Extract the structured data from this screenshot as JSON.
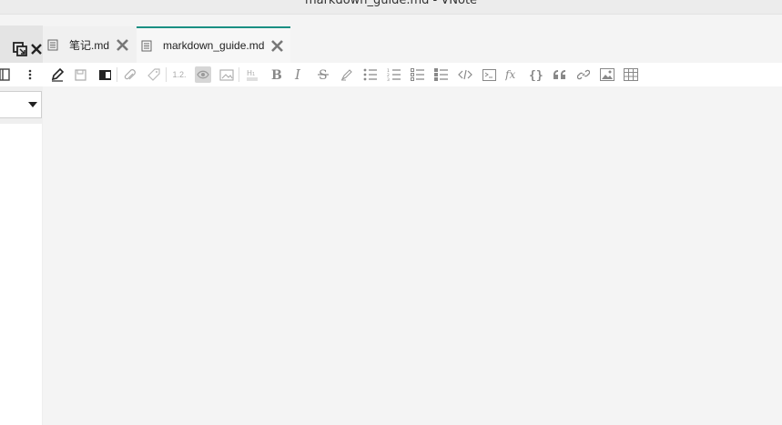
{
  "window": {
    "title": "markdown_guide.md - VNote"
  },
  "tabs": [
    {
      "label": "笔记.md",
      "active": false
    },
    {
      "label": "markdown_guide.md",
      "active": true
    }
  ],
  "colors": {
    "active_tab_accent": "#1a8f83",
    "background": "#f4f4f4",
    "icon": "#6e6e6e"
  },
  "toolbar_icons": [
    "notebook-icon",
    "more-vert-icon",
    "edit-pen-icon",
    "save-icon",
    "read-mode-icon",
    "attachment-icon",
    "tag-icon",
    "section-number-icon",
    "preview-eye-icon",
    "image-host-icon",
    "heading-icon",
    "bold-icon",
    "italic-icon",
    "strikethrough-icon",
    "highlight-icon",
    "bullet-list-icon",
    "numbered-list-icon",
    "todo-list-icon",
    "checked-list-icon",
    "inline-code-icon",
    "code-block-icon",
    "math-icon",
    "math-block-icon",
    "quote-icon",
    "link-icon",
    "image-icon",
    "table-icon"
  ],
  "toolbar_labels": {
    "section_number": "1.2."
  }
}
